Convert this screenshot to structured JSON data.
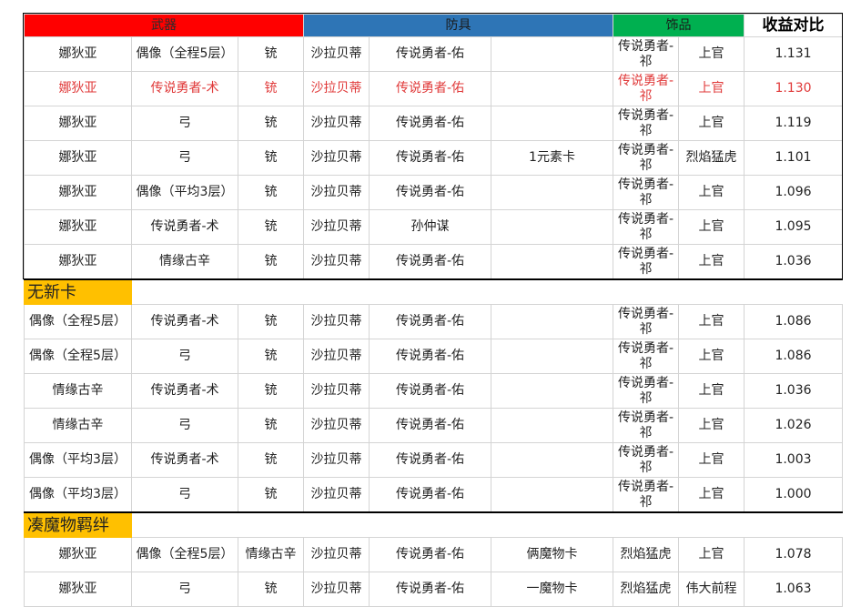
{
  "header": {
    "weapon": "武器",
    "armor": "防具",
    "accessory": "饰品",
    "ratio": "收益对比"
  },
  "group1": [
    [
      "娜狄亚",
      "偶像（全程5层）",
      "铳",
      "沙拉贝蒂",
      "传说勇者-佑",
      "",
      "传说勇者-祁",
      "上官",
      "1.131"
    ],
    [
      "娜狄亚",
      "传说勇者-术",
      "铳",
      "沙拉贝蒂",
      "传说勇者-佑",
      "",
      "传说勇者-祁",
      "上官",
      "1.130"
    ],
    [
      "娜狄亚",
      "弓",
      "铳",
      "沙拉贝蒂",
      "传说勇者-佑",
      "",
      "传说勇者-祁",
      "上官",
      "1.119"
    ],
    [
      "娜狄亚",
      "弓",
      "铳",
      "沙拉贝蒂",
      "传说勇者-佑",
      "1元素卡",
      "传说勇者-祁",
      "烈焰猛虎",
      "1.101"
    ],
    [
      "娜狄亚",
      "偶像（平均3层）",
      "铳",
      "沙拉贝蒂",
      "传说勇者-佑",
      "",
      "传说勇者-祁",
      "上官",
      "1.096"
    ],
    [
      "娜狄亚",
      "传说勇者-术",
      "铳",
      "沙拉贝蒂",
      "孙仲谋",
      "",
      "传说勇者-祁",
      "上官",
      "1.095"
    ],
    [
      "娜狄亚",
      "情缘古辛",
      "铳",
      "沙拉贝蒂",
      "传说勇者-佑",
      "",
      "传说勇者-祁",
      "上官",
      "1.036"
    ]
  ],
  "section2_title": "无新卡",
  "group2": [
    [
      "偶像（全程5层）",
      "传说勇者-术",
      "铳",
      "沙拉贝蒂",
      "传说勇者-佑",
      "",
      "传说勇者-祁",
      "上官",
      "1.086"
    ],
    [
      "偶像（全程5层）",
      "弓",
      "铳",
      "沙拉贝蒂",
      "传说勇者-佑",
      "",
      "传说勇者-祁",
      "上官",
      "1.086"
    ],
    [
      "情缘古辛",
      "传说勇者-术",
      "铳",
      "沙拉贝蒂",
      "传说勇者-佑",
      "",
      "传说勇者-祁",
      "上官",
      "1.036"
    ],
    [
      "情缘古辛",
      "弓",
      "铳",
      "沙拉贝蒂",
      "传说勇者-佑",
      "",
      "传说勇者-祁",
      "上官",
      "1.026"
    ],
    [
      "偶像（平均3层）",
      "传说勇者-术",
      "铳",
      "沙拉贝蒂",
      "传说勇者-佑",
      "",
      "传说勇者-祁",
      "上官",
      "1.003"
    ],
    [
      "偶像（平均3层）",
      "弓",
      "铳",
      "沙拉贝蒂",
      "传说勇者-佑",
      "",
      "传说勇者-祁",
      "上官",
      "1.000"
    ]
  ],
  "section3_title": "凑魔物羁绊",
  "group3": [
    [
      "娜狄亚",
      "偶像（全程5层）",
      "情缘古辛",
      "沙拉贝蒂",
      "传说勇者-佑",
      "俩魔物卡",
      "烈焰猛虎",
      "上官",
      "1.078"
    ],
    [
      "娜狄亚",
      "弓",
      "铳",
      "沙拉贝蒂",
      "传说勇者-佑",
      "一魔物卡",
      "烈焰猛虎",
      "伟大前程",
      "1.063"
    ]
  ],
  "colors": {
    "weapon_header": "#ff0000",
    "armor_header": "#2e75b6",
    "accessory_header": "#00b050",
    "section_label": "#ffc000",
    "highlight_text": "#e03a3a"
  }
}
